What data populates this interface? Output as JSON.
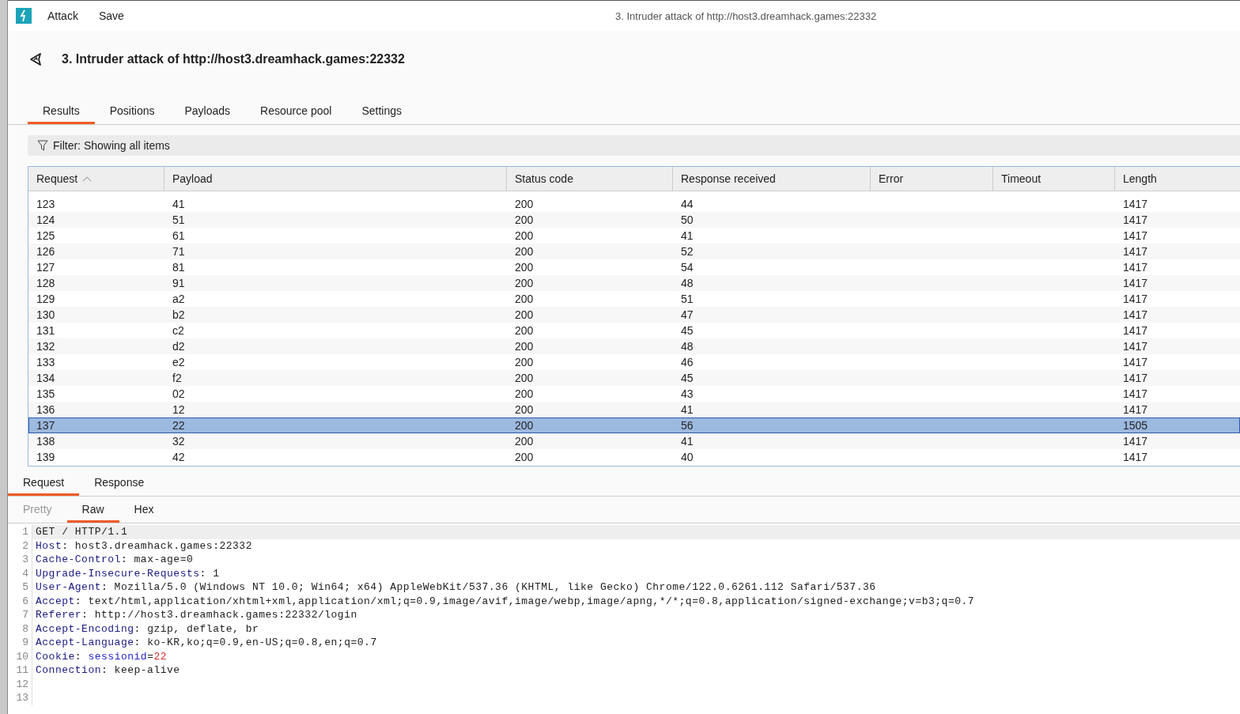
{
  "menu": {
    "items": [
      "Attack",
      "Save"
    ],
    "window_title": "3. Intruder attack of http://host3.dreamhack.games:22332"
  },
  "heading": "3. Intruder attack of http://host3.dreamhack.games:22332",
  "tabs": [
    {
      "label": "Results",
      "selected": true
    },
    {
      "label": "Positions",
      "selected": false
    },
    {
      "label": "Payloads",
      "selected": false
    },
    {
      "label": "Resource pool",
      "selected": false
    },
    {
      "label": "Settings",
      "selected": false
    }
  ],
  "filter": "Filter: Showing all items",
  "table": {
    "columns": [
      {
        "label": "Request",
        "sorted": true
      },
      {
        "label": "Payload",
        "sorted": false
      },
      {
        "label": "Status code",
        "sorted": false
      },
      {
        "label": "Response received",
        "sorted": false
      },
      {
        "label": "Error",
        "sorted": false
      },
      {
        "label": "Timeout",
        "sorted": false
      },
      {
        "label": "Length",
        "sorted": false
      }
    ],
    "rows": [
      {
        "cells": [
          "123",
          "41",
          "200",
          "44",
          "",
          "",
          "1417"
        ],
        "selected": false
      },
      {
        "cells": [
          "124",
          "51",
          "200",
          "50",
          "",
          "",
          "1417"
        ],
        "selected": false
      },
      {
        "cells": [
          "125",
          "61",
          "200",
          "41",
          "",
          "",
          "1417"
        ],
        "selected": false
      },
      {
        "cells": [
          "126",
          "71",
          "200",
          "52",
          "",
          "",
          "1417"
        ],
        "selected": false
      },
      {
        "cells": [
          "127",
          "81",
          "200",
          "54",
          "",
          "",
          "1417"
        ],
        "selected": false
      },
      {
        "cells": [
          "128",
          "91",
          "200",
          "48",
          "",
          "",
          "1417"
        ],
        "selected": false
      },
      {
        "cells": [
          "129",
          "a2",
          "200",
          "51",
          "",
          "",
          "1417"
        ],
        "selected": false
      },
      {
        "cells": [
          "130",
          "b2",
          "200",
          "47",
          "",
          "",
          "1417"
        ],
        "selected": false
      },
      {
        "cells": [
          "131",
          "c2",
          "200",
          "45",
          "",
          "",
          "1417"
        ],
        "selected": false
      },
      {
        "cells": [
          "132",
          "d2",
          "200",
          "48",
          "",
          "",
          "1417"
        ],
        "selected": false
      },
      {
        "cells": [
          "133",
          "e2",
          "200",
          "46",
          "",
          "",
          "1417"
        ],
        "selected": false
      },
      {
        "cells": [
          "134",
          "f2",
          "200",
          "45",
          "",
          "",
          "1417"
        ],
        "selected": false
      },
      {
        "cells": [
          "135",
          "02",
          "200",
          "43",
          "",
          "",
          "1417"
        ],
        "selected": false
      },
      {
        "cells": [
          "136",
          "12",
          "200",
          "41",
          "",
          "",
          "1417"
        ],
        "selected": false
      },
      {
        "cells": [
          "137",
          "22",
          "200",
          "56",
          "",
          "",
          "1505"
        ],
        "selected": true
      },
      {
        "cells": [
          "138",
          "32",
          "200",
          "41",
          "",
          "",
          "1417"
        ],
        "selected": false
      },
      {
        "cells": [
          "139",
          "42",
          "200",
          "40",
          "",
          "",
          "1417"
        ],
        "selected": false
      }
    ]
  },
  "message_tabs": [
    {
      "label": "Request",
      "selected": true
    },
    {
      "label": "Response",
      "selected": false
    }
  ],
  "view_tabs": [
    {
      "label": "Pretty",
      "selected": false,
      "disabled": true
    },
    {
      "label": "Raw",
      "selected": true,
      "disabled": false
    },
    {
      "label": "Hex",
      "selected": false,
      "disabled": false
    }
  ],
  "editor": {
    "lines": [
      {
        "number": "1",
        "current": true,
        "parts": [
          {
            "kind": "plain",
            "text": "GET / HTTP/1.1"
          }
        ]
      },
      {
        "number": "2",
        "current": false,
        "parts": [
          {
            "kind": "header",
            "text": "Host"
          },
          {
            "kind": "plain",
            "text": ": host3.dreamhack.games:22332"
          }
        ]
      },
      {
        "number": "3",
        "current": false,
        "parts": [
          {
            "kind": "header",
            "text": "Cache-Control"
          },
          {
            "kind": "plain",
            "text": ": max-age=0"
          }
        ]
      },
      {
        "number": "4",
        "current": false,
        "parts": [
          {
            "kind": "header",
            "text": "Upgrade-Insecure-Requests"
          },
          {
            "kind": "plain",
            "text": ": 1"
          }
        ]
      },
      {
        "number": "5",
        "current": false,
        "parts": [
          {
            "kind": "header",
            "text": "User-Agent"
          },
          {
            "kind": "plain",
            "text": ": Mozilla/5.0 (Windows NT 10.0; Win64; x64) AppleWebKit/537.36 (KHTML, like Gecko) Chrome/122.0.6261.112 Safari/537.36"
          }
        ]
      },
      {
        "number": "6",
        "current": false,
        "parts": [
          {
            "kind": "header",
            "text": "Accept"
          },
          {
            "kind": "plain",
            "text": ": text/html,application/xhtml+xml,application/xml;q=0.9,image/avif,image/webp,image/apng,*/*;q=0.8,application/signed-exchange;v=b3;q=0.7"
          }
        ]
      },
      {
        "number": "7",
        "current": false,
        "parts": [
          {
            "kind": "header",
            "text": "Referer"
          },
          {
            "kind": "plain",
            "text": ": http://host3.dreamhack.games:22332/login"
          }
        ]
      },
      {
        "number": "8",
        "current": false,
        "parts": [
          {
            "kind": "header",
            "text": "Accept-Encoding"
          },
          {
            "kind": "plain",
            "text": ": gzip, deflate, br"
          }
        ]
      },
      {
        "number": "9",
        "current": false,
        "parts": [
          {
            "kind": "header",
            "text": "Accept-Language"
          },
          {
            "kind": "plain",
            "text": ": ko-KR,ko;q=0.9,en-US;q=0.8,en;q=0.7"
          }
        ]
      },
      {
        "number": "10",
        "current": false,
        "parts": [
          {
            "kind": "header",
            "text": "Cookie"
          },
          {
            "kind": "plain",
            "text": ": "
          },
          {
            "kind": "param",
            "text": "sessionid"
          },
          {
            "kind": "plain",
            "text": "="
          },
          {
            "kind": "payload",
            "text": "22"
          }
        ]
      },
      {
        "number": "11",
        "current": false,
        "parts": [
          {
            "kind": "header",
            "text": "Connection"
          },
          {
            "kind": "plain",
            "text": ": keep-alive"
          }
        ]
      },
      {
        "number": "12",
        "current": false
      },
      {
        "number": "13",
        "current": false
      }
    ]
  }
}
